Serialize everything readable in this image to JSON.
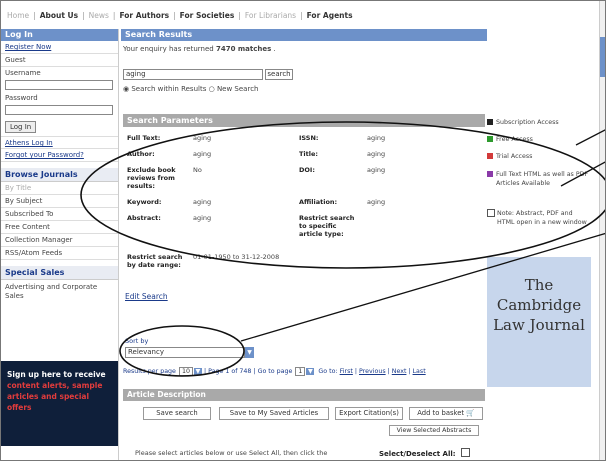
{
  "topnav": {
    "home": "Home",
    "about": "About Us",
    "news": "News",
    "authors": "For Authors",
    "societies": "For Societies",
    "librarians": "For Librarians",
    "agents": "For Agents"
  },
  "sidebar": {
    "login_head": "Log In",
    "register": "Register Now",
    "guest": "Guest",
    "username_label": "Username",
    "password_label": "Password",
    "login_btn": "Log In",
    "athens": "Athens Log In",
    "forgot": "Forgot your Password?",
    "browse_head": "Browse Journals",
    "by_title": "By Title",
    "by_subject": "By Subject",
    "subscribed": "Subscribed To",
    "free": "Free Content",
    "collection": "Collection Manager",
    "rss": "RSS/Atom Feeds",
    "sales_head": "Special Sales",
    "advertising": "Advertising and Corporate Sales",
    "promo_line1": "Sign up here to receive",
    "promo_line2": "content alerts, sample",
    "promo_line3": "articles and special offers"
  },
  "main": {
    "head": "Search Results",
    "enquiry_prefix": "Your enquiry has returned",
    "matches": "7470 matches",
    "enquiry_suffix": ".",
    "search_value": "aging",
    "search_btn": "search",
    "radio_within": "Search within Results",
    "radio_new": "New Search",
    "params_head": "Search Parameters",
    "params": {
      "fulltext_l": "Full Text:",
      "fulltext_v": "aging",
      "issn_l": "ISSN:",
      "issn_v": "aging",
      "author_l": "Author:",
      "author_v": "aging",
      "title_l": "Title:",
      "title_v": "aging",
      "exclude_l": "Exclude book reviews from results:",
      "exclude_v": "No",
      "doi_l": "DOI:",
      "doi_v": "aging",
      "keyword_l": "Keyword:",
      "keyword_v": "aging",
      "affil_l": "Affiliation:",
      "affil_v": "aging",
      "abstract_l": "Abstract:",
      "abstract_v": "aging",
      "restrict_l": "Restrict search to specific article type:",
      "date_l": "Restrict search by date range:",
      "date_v": "01-01-1950 to 31-12-2008"
    },
    "edit_search": "Edit Search",
    "sort_label": "Sort by",
    "sort_value": "Relevancy",
    "rpp_label": "Results per page",
    "rpp_value": "10",
    "page_info": "Page 1 of 748",
    "goto_label": "Go to page",
    "goto_value": "1",
    "goto_to": "Go to:",
    "first": "First",
    "previous": "Previous",
    "next": "Next",
    "last": "Last",
    "ad_head": "Article Description",
    "save_search": "Save search",
    "save_saved": "Save to My Saved Articles",
    "export": "Export Citation(s)",
    "add_basket": "Add to basket",
    "view_abstracts": "View Selected Abstracts",
    "notice": "Please select articles below or use Select All, then click the appropriate button above.",
    "select_all": "Select/Deselect All:"
  },
  "right": {
    "sub_access": "Subscription Access",
    "free_access": "Free Access",
    "trial_access": "Trial Access",
    "fulltext_html": "Full Text HTML as well as PDF Articles Available",
    "note": "Note: Abstract, PDF and HTML open in a new window",
    "journal_line1": "The",
    "journal_line2": "Cambridge",
    "journal_line3": "Law Journal"
  },
  "colors": {
    "header_blue": "#6d91c9",
    "subscription": "#222222",
    "free": "#2e9a2e",
    "trial": "#d23a3a",
    "fulltext": "#8a3aa8"
  }
}
